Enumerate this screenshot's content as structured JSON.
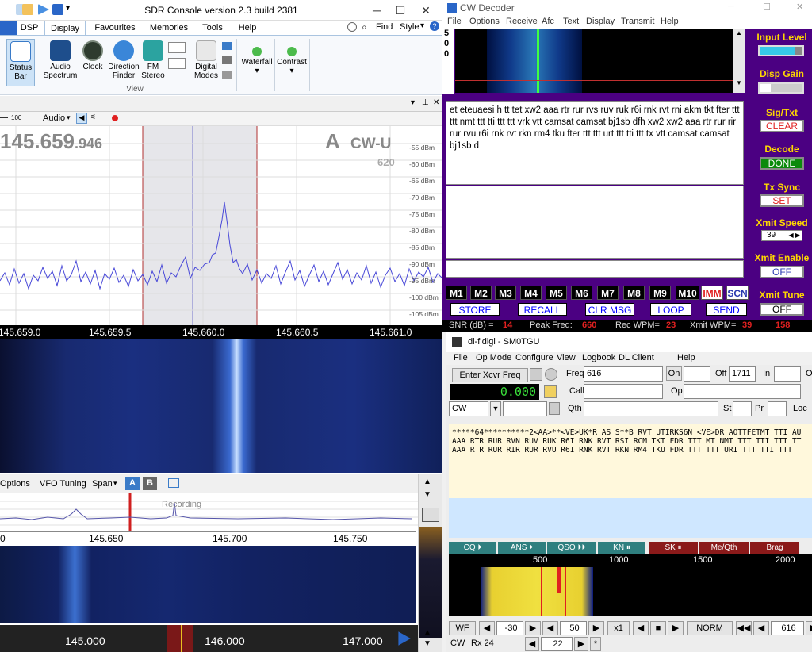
{
  "sdr": {
    "title": "SDR Console version 2.3 build 2381",
    "tabs": [
      "",
      "DSP",
      "Display",
      "Favourites",
      "Memories",
      "Tools",
      "Help"
    ],
    "search_find": "Find",
    "search_style": "Style",
    "ribbon": {
      "status_bar": "Status Bar",
      "audio_spectrum": "Audio Spectrum",
      "clock": "Clock",
      "direction_finder": "Direction Finder",
      "fm_stereo": "FM Stereo",
      "digital_modes": "Digital Modes",
      "waterfall": "Waterfall",
      "contrast": "Contrast",
      "group_view": "View"
    },
    "spectrum": {
      "audio_label": "Audio",
      "scale_100": "100",
      "frequency_main": "145.659",
      "frequency_sub": ".946",
      "vfo": "A",
      "mode": "CW-U",
      "bandwidth": "620",
      "dbm_labels": [
        "-55 dBm",
        "-60 dBm",
        "-65 dBm",
        "-70 dBm",
        "-75 dBm",
        "-80 dBm",
        "-85 dBm",
        "-90 dBm",
        "-95 dBm",
        "-100 dBm",
        "-105 dBm"
      ],
      "freq_ticks": [
        "145.659.0",
        "145.659.5",
        "145.660.0",
        "145.660.5",
        "145.661.0"
      ]
    },
    "band": {
      "options": "Options",
      "vfo_tuning": "VFO Tuning",
      "span": "Span",
      "vfo_a": "A",
      "vfo_b": "B",
      "recording": "Recording",
      "ticks": [
        "0",
        "145.650",
        "145.700",
        "145.750"
      ],
      "bottom_ticks": [
        "145.000",
        "146.000",
        "147.000"
      ]
    }
  },
  "cw": {
    "title": "CW Decoder",
    "menu": [
      "File",
      "Options",
      "Receive",
      "Afc",
      "Text",
      "Display",
      "Transmit",
      "Help"
    ],
    "level_digits": [
      "5",
      "0",
      "0"
    ],
    "decoded_text": "et  eteuaesi h tt tet   xw2 aaa rtr rur rvs ruv ruk r6i rnk rvt rni akm tkt fter ttt ttt nmt ttt tti ttt ttt vrk vtt camsat camsat bj1sb dfh xw2 xw2 aaa rtr rur rir rur rvu r6i rnk rvt rkn rm4 tku fter ttt ttt urt ttt tti ttt tx vtt camsat camsat bj1sb d",
    "side": {
      "input_level": "Input Level",
      "disp_gain": "Disp Gain",
      "sig_txt": "Sig/Txt",
      "clear": "CLEAR",
      "decode": "Decode",
      "done": "DONE",
      "tx_sync": "Tx Sync",
      "set": "SET",
      "xmit_speed": "Xmit Speed",
      "xmit_speed_value": "39",
      "xmit_enable": "Xmit Enable",
      "off1": "OFF",
      "xmit_tune": "Xmit Tune",
      "off2": "OFF"
    },
    "macros": [
      "M1",
      "M2",
      "M3",
      "M4",
      "M5",
      "M6",
      "M7",
      "M8",
      "M9",
      "M10",
      "IMM",
      "SCN"
    ],
    "actions": [
      "STORE",
      "RECALL",
      "CLR MSG",
      "LOOP",
      "SEND"
    ],
    "status": {
      "snr_label": "SNR (dB) =",
      "snr": "14",
      "peak_label": "Peak Freq:",
      "peak": "660",
      "rec_label": "Rec WPM=",
      "rec": "23",
      "xmit_label": "Xmit WPM=",
      "xmit": "39",
      "last": "158"
    }
  },
  "fl": {
    "title": "dl-fldigi - SM0TGU",
    "menu": [
      "File",
      "Op Mode",
      "Configure",
      "View",
      "Logbook",
      "DL Client",
      "Help"
    ],
    "enter_xcvr": "Enter Xcvr Freq",
    "freq_label": "Freq",
    "freq_value": "616",
    "on_label": "On",
    "off_label": "Off",
    "off_value": "1711",
    "in_label": "In",
    "o_label": "O",
    "display_freq": "0.000",
    "call_label": "Call",
    "op_label": "Op",
    "mode": "CW",
    "qth_label": "Qth",
    "st_label": "St",
    "pr_label": "Pr",
    "loc_label": "Loc",
    "rx_lines": [
      "*****64**********2<AA>**<VE>UK*R AS S**B RVT UTIRKS6N <VE>DR AOTTFETMT TTI AU",
      "AAA RTR RUR RVN RUV RUK R6I RNK RVT RSI RCM TKT FDR TTT MT NMT TTT TTI TTT TT",
      "AAA RTR RUR RIR RUR RVU R6I RNK RVT RKN RM4 TKU FDR TTT TTT URI TTT TTI TTT T"
    ],
    "macros": [
      "CQ",
      "ANS",
      "QSO",
      "KN",
      "SK",
      "Me/Qth",
      "Brag"
    ],
    "wf_ticks": [
      "500",
      "1000",
      "1500",
      "2000"
    ],
    "bottom": {
      "wf": "WF",
      "minus30": "-30",
      "fifty": "50",
      "x1": "x1",
      "norm": "NORM",
      "freq": "616",
      "mode": "CW",
      "rx": "Rx 24",
      "val22": "22",
      "star": "*"
    }
  },
  "colors": {
    "cw_bg": "#4b0082",
    "cw_label": "#ffd700",
    "macro_teal": "#2f7f7f",
    "macro_red": "#8b1a1a"
  }
}
